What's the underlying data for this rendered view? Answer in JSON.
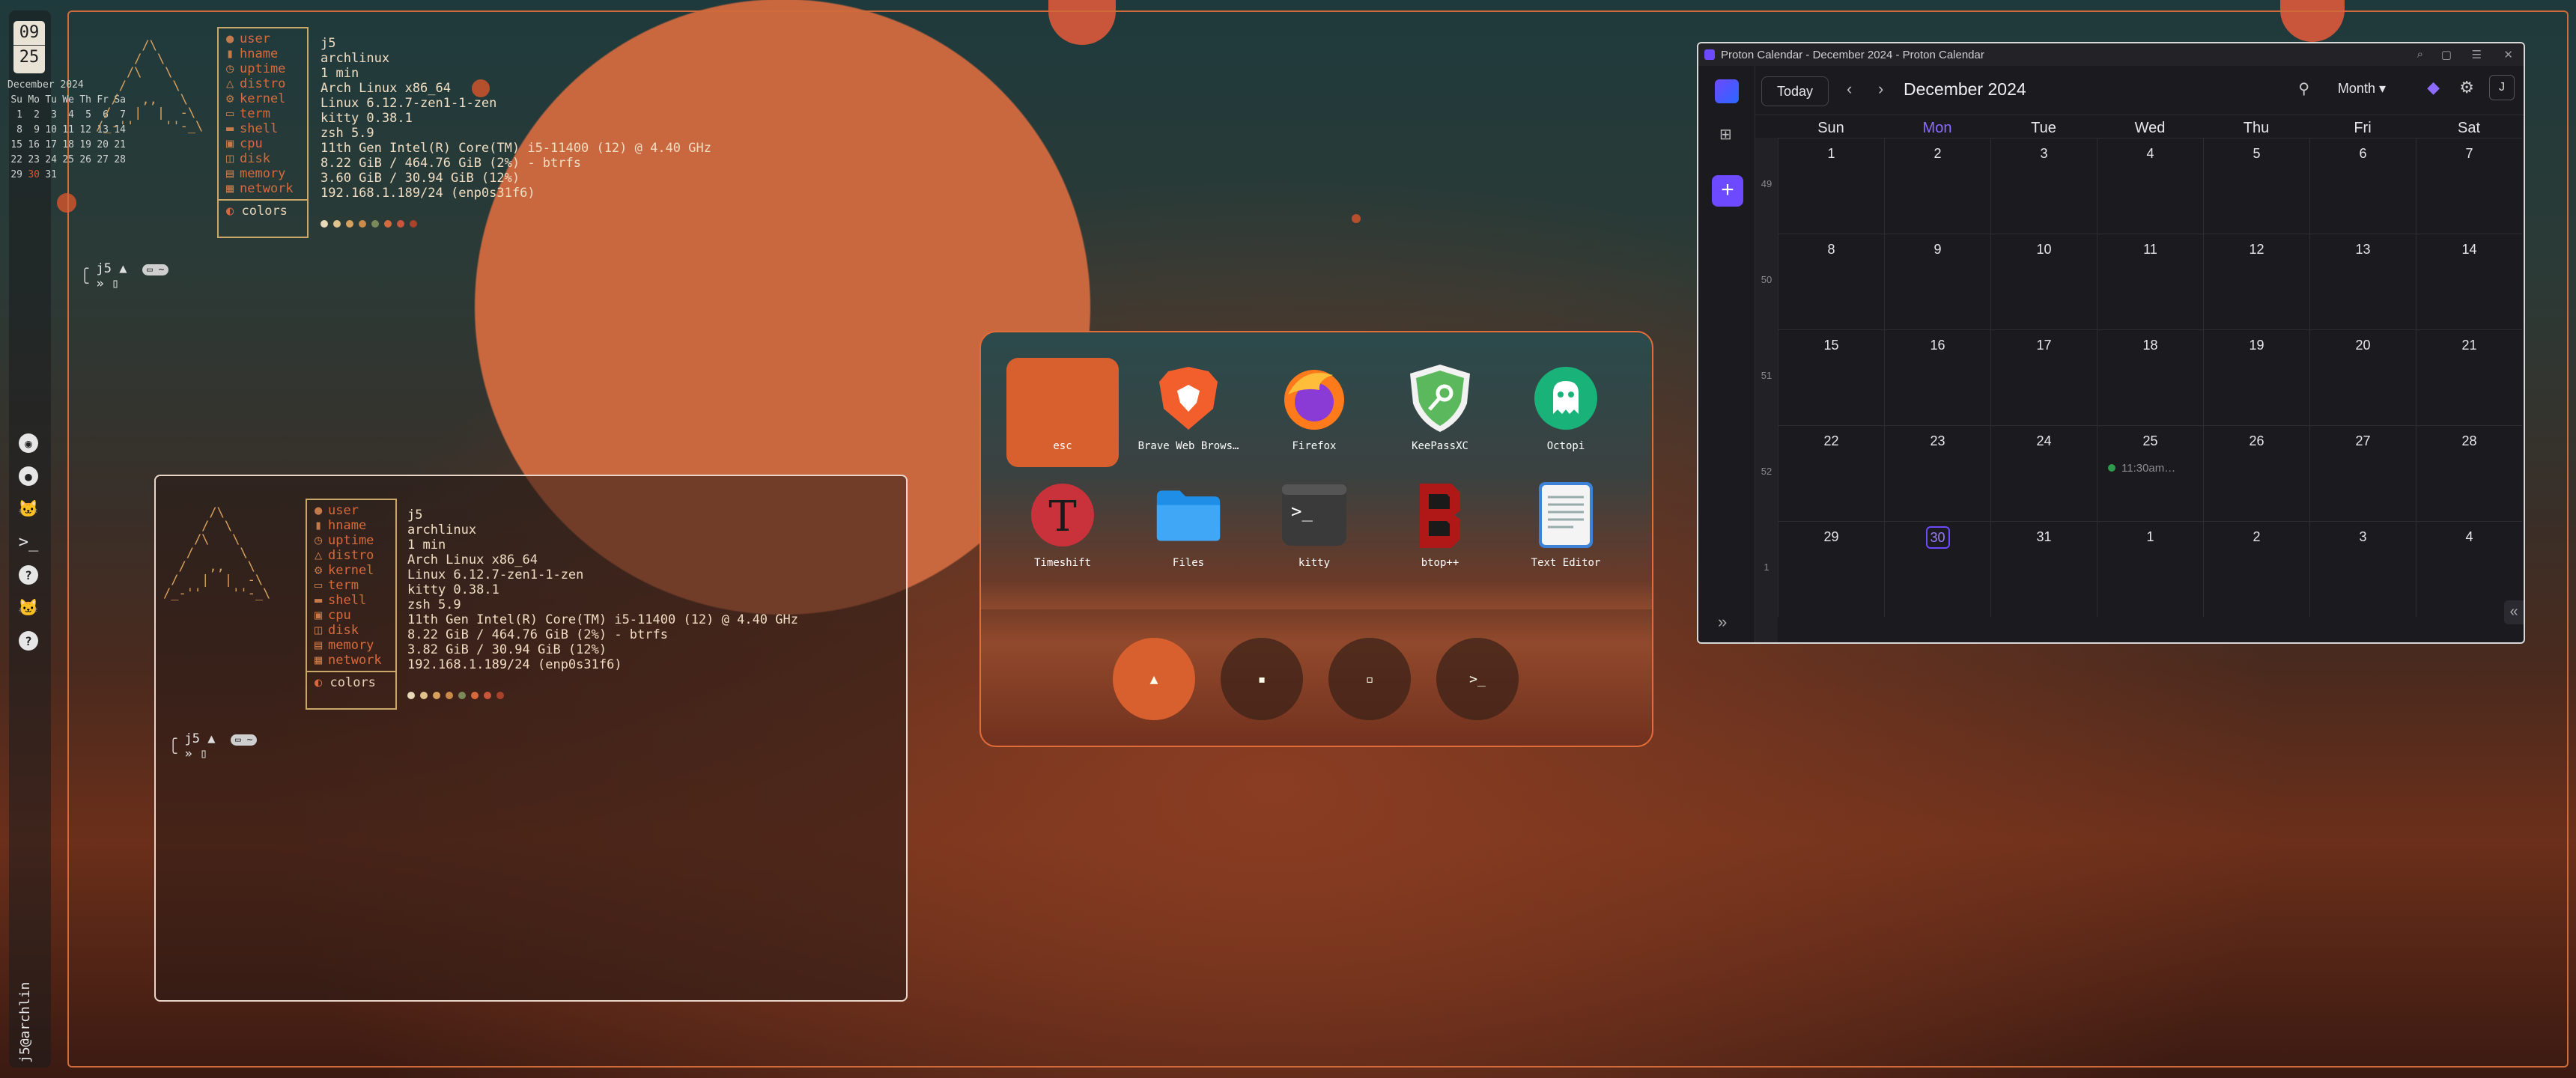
{
  "clock": {
    "hour": "09",
    "minute": "25"
  },
  "mini_calendar": {
    "title": "December 2024",
    "weekdays": [
      "Su",
      "Mo",
      "Tu",
      "We",
      "Th",
      "Fr",
      "Sa"
    ],
    "weeks": [
      [
        "1",
        "2",
        "3",
        "4",
        "5",
        "6",
        "7"
      ],
      [
        "8",
        "9",
        "10",
        "11",
        "12",
        "13",
        "14"
      ],
      [
        "15",
        "16",
        "17",
        "18",
        "19",
        "20",
        "21"
      ],
      [
        "22",
        "23",
        "24",
        "25",
        "26",
        "27",
        "28"
      ],
      [
        "29",
        "30",
        "31",
        "",
        "",
        "",
        ""
      ]
    ],
    "today": "30"
  },
  "sysinfo_keys": [
    "user",
    "hname",
    "uptime",
    "distro",
    "kernel",
    "term",
    "shell",
    "cpu",
    "disk",
    "memory",
    "network"
  ],
  "sysinfo_top": {
    "user": "j5",
    "hname": "archlinux",
    "uptime": "1 min",
    "distro": "Arch Linux x86_64",
    "kernel": "Linux 6.12.7-zen1-1-zen",
    "term": "kitty 0.38.1",
    "shell": "zsh 5.9",
    "cpu": "11th Gen Intel(R) Core(TM) i5-11400 (12) @ 4.40 GHz",
    "disk": "8.22 GiB / 464.76 GiB (2%) - btrfs",
    "memory": "3.60 GiB / 30.94 GiB (12%)",
    "network": "192.168.1.189/24 (enp0s31f6)",
    "colors": "colors"
  },
  "sysinfo_term": {
    "user": "j5",
    "hname": "archlinux",
    "uptime": "1 min",
    "distro": "Arch Linux x86_64",
    "kernel": "Linux 6.12.7-zen1-1-zen",
    "term": "kitty 0.38.1",
    "shell": "zsh 5.9",
    "cpu": "11th Gen Intel(R) Core(TM) i5-11400 (12) @ 4.40 GHz",
    "disk": "8.22 GiB / 464.76 GiB (2%) - btrfs",
    "memory": "3.82 GiB / 30.94 GiB (12%)",
    "network": "192.168.1.189/24 (enp0s31f6)",
    "colors": "colors"
  },
  "palette": [
    "#e8d9b8",
    "#e0c28a",
    "#d9a15e",
    "#c98a4a",
    "#7a8a5a",
    "#d66a3d",
    "#c9553a",
    "#a8422a"
  ],
  "prompt": {
    "user": "j5",
    "arrow": "»",
    "tag": "~"
  },
  "launcher": {
    "apps": [
      {
        "label": "esc",
        "icon": "esc-tile"
      },
      {
        "label": "Brave Web Brows…",
        "icon": "brave-icon"
      },
      {
        "label": "Firefox",
        "icon": "firefox-icon"
      },
      {
        "label": "KeePassXC",
        "icon": "keepassxc-icon"
      },
      {
        "label": "Octopi",
        "icon": "octopi-icon"
      },
      {
        "label": "Timeshift",
        "icon": "timeshift-icon"
      },
      {
        "label": "Files",
        "icon": "folder-icon"
      },
      {
        "label": "kitty",
        "icon": "terminal-icon"
      },
      {
        "label": "btop++",
        "icon": "btop-icon"
      },
      {
        "label": "Text Editor",
        "icon": "text-editor-icon"
      }
    ]
  },
  "calendar": {
    "window_title": "Proton Calendar - December 2024 - Proton Calendar",
    "today_label": "Today",
    "month_title": "December 2024",
    "view": "Month",
    "avatar": "J",
    "weekdays": [
      "Sun",
      "Mon",
      "Tue",
      "Wed",
      "Thu",
      "Fri",
      "Sat"
    ],
    "week_numbers": [
      "49",
      "50",
      "51",
      "52",
      "1"
    ],
    "weeks": [
      [
        "1",
        "2",
        "3",
        "4",
        "5",
        "6",
        "7"
      ],
      [
        "8",
        "9",
        "10",
        "11",
        "12",
        "13",
        "14"
      ],
      [
        "15",
        "16",
        "17",
        "18",
        "19",
        "20",
        "21"
      ],
      [
        "22",
        "23",
        "24",
        "25",
        "26",
        "27",
        "28"
      ],
      [
        "29",
        "30",
        "31",
        "1",
        "2",
        "3",
        "4"
      ]
    ],
    "today": "30",
    "event": {
      "day": "25",
      "time": "11:30am…"
    }
  },
  "dock": {
    "user_label": "j5@archlin"
  },
  "accent": "#d8602e"
}
